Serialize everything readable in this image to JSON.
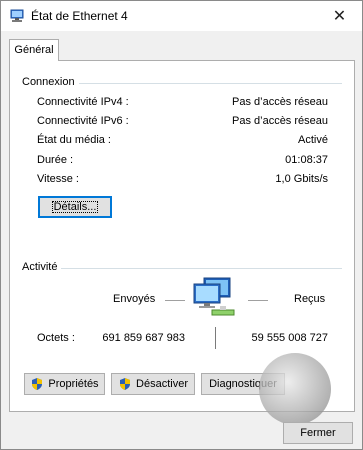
{
  "window": {
    "title": "État de Ethernet 4",
    "close_glyph": "✕"
  },
  "tabs": [
    {
      "label": "Général",
      "selected": true
    }
  ],
  "connexion": {
    "heading": "Connexion",
    "rows": [
      {
        "label": "Connectivité IPv4 :",
        "value": "Pas d’accès réseau"
      },
      {
        "label": "Connectivité IPv6 :",
        "value": "Pas d’accès réseau"
      },
      {
        "label": "État du média :",
        "value": "Activé"
      },
      {
        "label": "Durée :",
        "value": "01:08:37"
      },
      {
        "label": "Vitesse :",
        "value": "1,0 Gbits/s"
      }
    ],
    "details_button": "Détails..."
  },
  "activite": {
    "heading": "Activité",
    "sent_label": "Envoyés",
    "received_label": "Reçus",
    "bytes_label": "Octets :",
    "bytes_sent": "691 859 687 983",
    "bytes_received": "59 555 008 727",
    "network_icon": "network-computers-icon"
  },
  "buttons": {
    "properties": "Propriétés",
    "disable": "Désactiver",
    "diagnose": "Diagnostiquer",
    "close": "Fermer"
  },
  "colors": {
    "accent": "#0078d7",
    "shield_blue": "#2b5fb4",
    "shield_yellow": "#f2c200"
  }
}
